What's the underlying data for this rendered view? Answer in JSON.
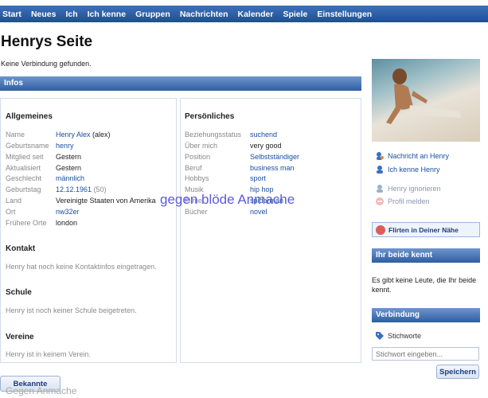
{
  "nav": [
    "Start",
    "Neues",
    "Ich",
    "Ich kenne",
    "Gruppen",
    "Nachrichten",
    "Kalender",
    "Spiele",
    "Einstellungen"
  ],
  "page_title": "Henrys Seite",
  "status": "Keine Verbindung gefunden.",
  "info_header": "Infos",
  "general": {
    "heading": "Allgemeines",
    "rows": [
      {
        "label": "Name",
        "value": "Henry Alex",
        "extra": "(alex)"
      },
      {
        "label": "Geburtsname",
        "value": "henry"
      },
      {
        "label": "Mitglied seit",
        "value": "Gestern"
      },
      {
        "label": "Aktualisiert",
        "value": "Gestern"
      },
      {
        "label": "Geschlecht",
        "value": "männlich"
      },
      {
        "label": "Geburtstag",
        "value": "12.12.1961",
        "extra": "(50)"
      },
      {
        "label": "Land",
        "value": "Vereinigte Staaten von Amerika"
      },
      {
        "label": "Ort",
        "value": "nw32er"
      },
      {
        "label": "Frühere Orte",
        "value": "london"
      }
    ]
  },
  "personal": {
    "heading": "Persönliches",
    "rows": [
      {
        "label": "Beziehungsstatus",
        "value": "suchend"
      },
      {
        "label": "Über mich",
        "value": "very good"
      },
      {
        "label": "Position",
        "value": "Selbstständiger"
      },
      {
        "label": "Beruf",
        "value": "business man"
      },
      {
        "label": "Hobbys",
        "value": "sport"
      },
      {
        "label": "Musik",
        "value": "hip hop"
      },
      {
        "label": "Filme",
        "value": "spiderman"
      },
      {
        "label": "Bücher",
        "value": "novel"
      }
    ]
  },
  "contact": {
    "heading": "Kontakt",
    "note": "Henry hat noch keine Kontaktinfos eingetragen."
  },
  "school": {
    "heading": "Schule",
    "note": "Henry ist noch keiner Schule beigetreten."
  },
  "clubs": {
    "heading": "Vereine",
    "note": "Henry ist in keinem Verein."
  },
  "actions": {
    "message": "Nachricht an Henry",
    "know": "Ich kenne Henry",
    "ignore": "Henry ignorieren",
    "report": "Profil melden"
  },
  "flirt_label": "Flirten in Deiner Nähe",
  "mutual": {
    "heading": "Ihr beide kennt",
    "text": "Es gibt keine Leute, die Ihr beide kennt."
  },
  "connection": {
    "heading": "Verbindung",
    "keyword_label": "Stichworte",
    "placeholder": "Stichwort eingeben...",
    "search_button": "Speichern"
  },
  "bottom_button": "Bekannte",
  "watermark_overlay": "gegen blöde Anmache",
  "bottom_overlay": "Gegen Anmache",
  "colors": {
    "nav": "#1e4f95",
    "link": "#1a4fa0",
    "overlay": "#5b5bd8"
  }
}
